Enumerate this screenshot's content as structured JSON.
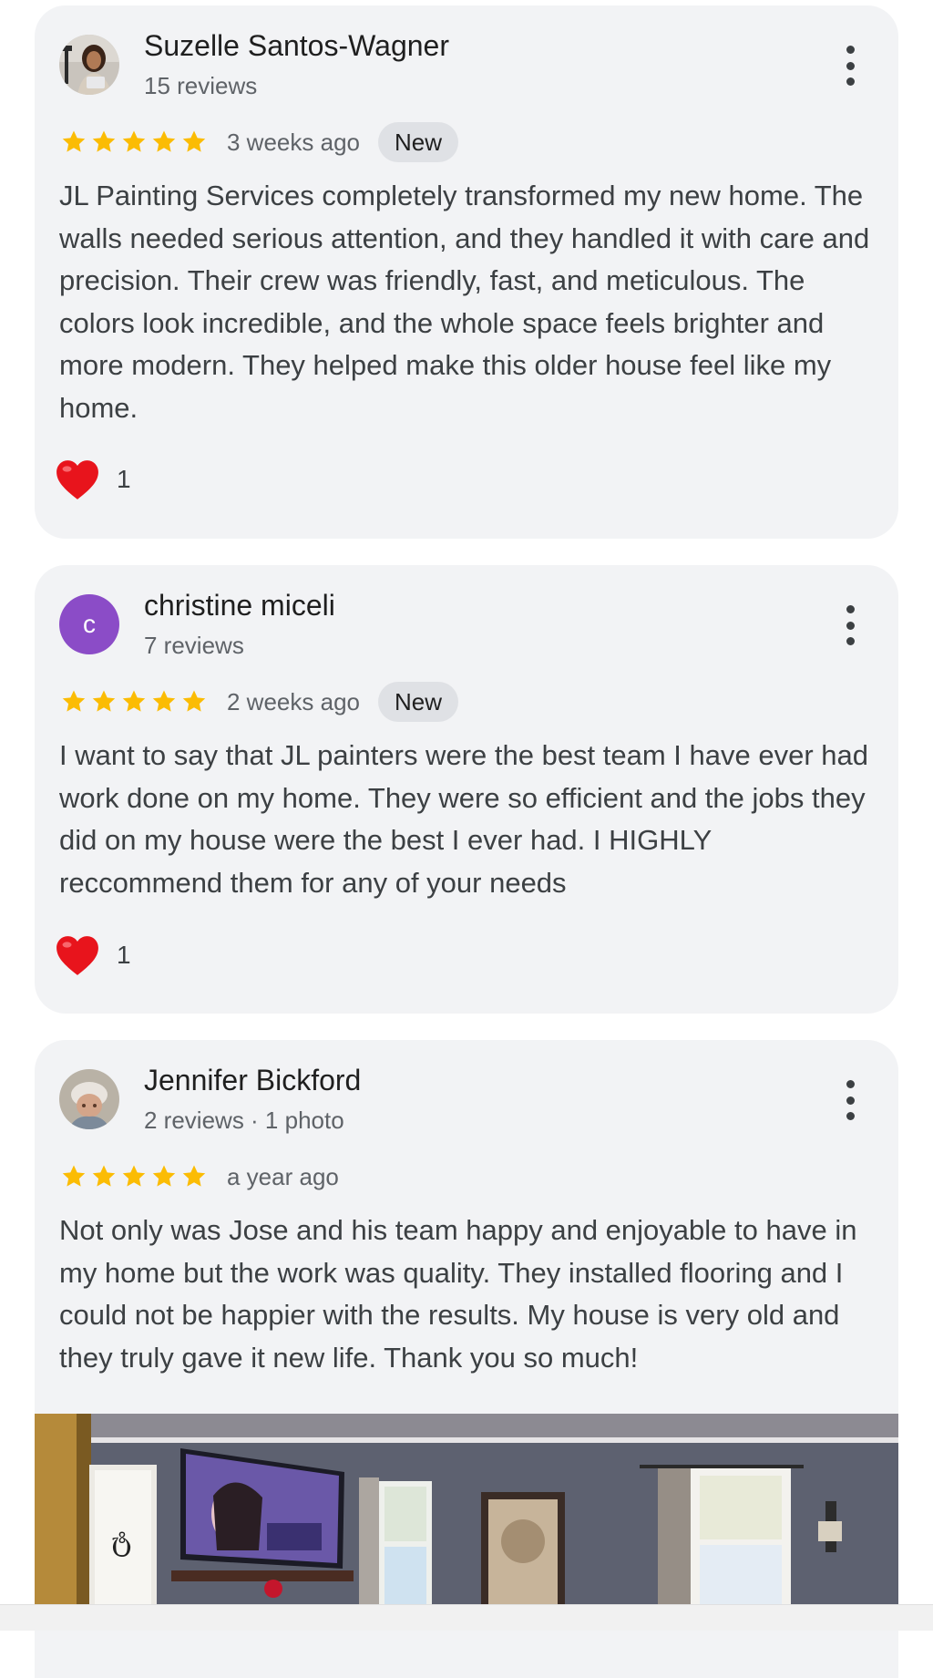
{
  "reviews": [
    {
      "author": "Suzelle Santos-Wagner",
      "meta": "15 reviews",
      "rating": 5,
      "time": "3 weeks ago",
      "badge": "New",
      "text": "JL Painting Services completely transformed my new home. The walls needed serious attention, and they handled it with care and precision. Their crew was friendly, fast, and meticulous. The colors look incredible, and the whole space feels brighter and more modern. They helped make this older house feel like my home.",
      "reaction_count": "1"
    },
    {
      "author": "christine miceli",
      "avatar_letter": "c",
      "meta": "7 reviews",
      "rating": 5,
      "time": "2 weeks ago",
      "badge": "New",
      "text": "I want to say that JL painters were the best team I have ever had work done on my home. They were so efficient and the jobs they did on my house were the best I ever had. I HIGHLY reccommend them for any of your needs",
      "reaction_count": "1"
    },
    {
      "author": "Jennifer Bickford",
      "meta": "2 reviews · 1 photo",
      "rating": 5,
      "time": "a year ago",
      "text": "Not only was Jose and his team happy and enjoyable to have in my home but the work was quality. They installed flooring and I could not be happier with the results. My house is very old and they truly gave it new life. Thank you so much!"
    }
  ],
  "icons": {
    "star": "star-icon",
    "heart": "heart-icon",
    "menu": "more-vert-icon"
  },
  "colors": {
    "star": "#fbbc04",
    "heart": "#e8141c",
    "card_background": "#f2f3f5",
    "badge_background": "#dfe1e5",
    "avatar_purple": "#8b4cc7"
  }
}
